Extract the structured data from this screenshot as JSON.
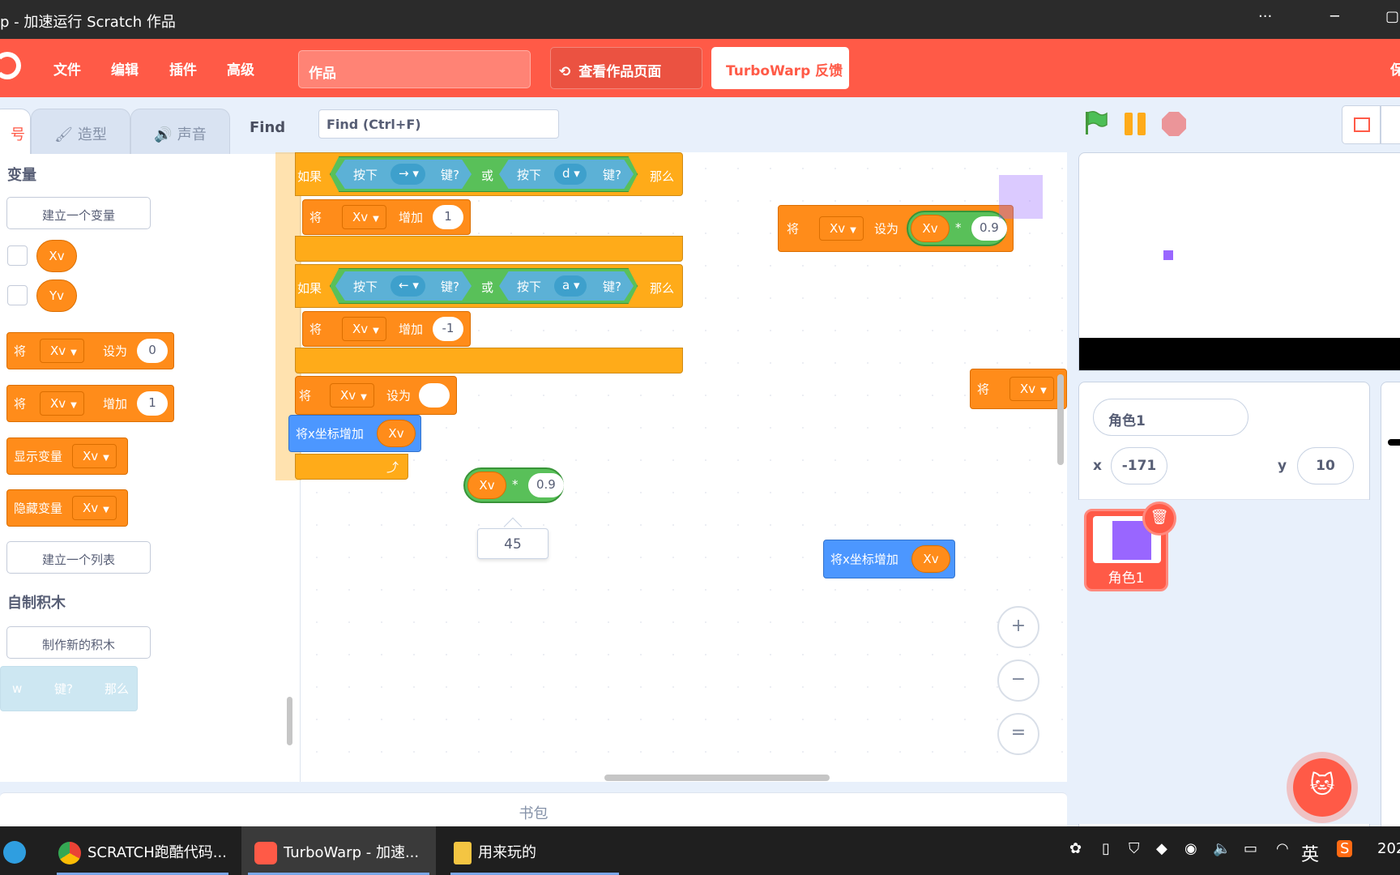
{
  "window": {
    "title": "p - 加速运行 Scratch 作品",
    "more": "···",
    "minimize": "─",
    "maximize": "▢"
  },
  "menubar": {
    "items": [
      "文件",
      "编辑",
      "插件",
      "高级"
    ],
    "project_title": "作品",
    "see_project": "查看作品页面",
    "feedback": "TurboWarp 反馈",
    "save_partial": "保"
  },
  "tabs": {
    "code_partial": "号",
    "costumes": "造型",
    "sounds": "声音"
  },
  "find": {
    "label": "Find",
    "placeholder": "Find (Ctrl+F)"
  },
  "palette": {
    "variables_title": "变量",
    "make_variable": "建立一个变量",
    "var1": "Xv",
    "var2": "Yv",
    "set_label": "将",
    "set_to": "设为",
    "set_value": "0",
    "change_by": "增加",
    "change_value": "1",
    "show_var": "显示变量",
    "hide_var": "隐藏变量",
    "make_list": "建立一个列表",
    "my_blocks_title": "自制积木",
    "make_block": "制作新的积木",
    "ghost_key": "w",
    "ghost_key_q": "键?",
    "ghost_then": "那么"
  },
  "script": {
    "if": "如果",
    "press": "按下",
    "key_q": "键?",
    "or": "或",
    "then": "那么",
    "key_right": "→",
    "key_d": "d",
    "key_left": "←",
    "key_a": "a",
    "set": "将",
    "var": "Xv",
    "change": "增加",
    "val_1": "1",
    "val_neg1": "-1",
    "set_to": "设为",
    "motion_change_x": "将x坐标增加",
    "multiply": "*",
    "factor": "0.9",
    "tooltip_value": "45"
  },
  "workspace": {
    "backpack": "书包",
    "zoom_in": "+",
    "zoom_out": "−",
    "zoom_reset": "="
  },
  "sprite": {
    "name": "角色1",
    "x_label": "x",
    "x": "-171",
    "y_label": "y",
    "y": "10",
    "thumb_label": "角色1"
  },
  "taskbar": {
    "items": [
      "SCRATCH跑酷代码...",
      "TurboWarp - 加速...",
      "用来玩的"
    ],
    "ime": "英",
    "clock_partial": "202"
  },
  "colors": {
    "accent": "#ff5a47",
    "variables": "#ff8c1a",
    "control": "#ffab19",
    "sensing": "#5cb1d6",
    "operators": "#59c059",
    "motion": "#4c97ff",
    "sprite": "#9966ff"
  }
}
